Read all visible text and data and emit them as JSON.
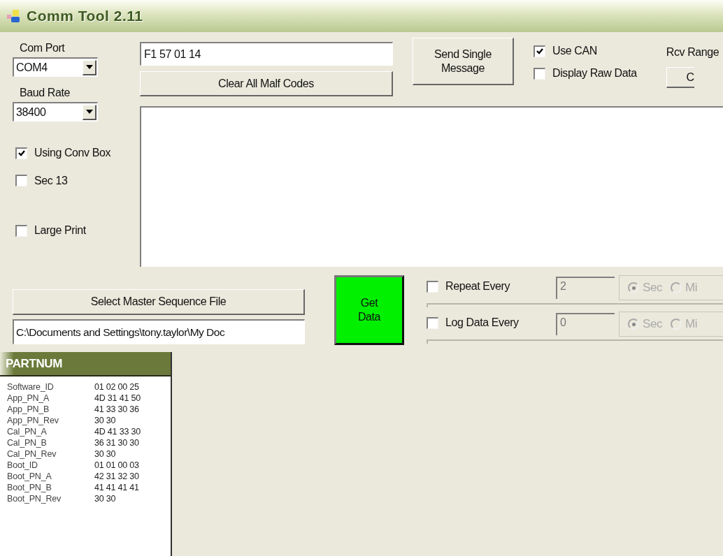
{
  "window": {
    "title": "Comm Tool 2.11"
  },
  "com_port": {
    "label": "Com Port",
    "value": "COM4"
  },
  "baud_rate": {
    "label": "Baud Rate",
    "value": "38400"
  },
  "options": [
    {
      "label": "Using Conv Box",
      "checked": true
    },
    {
      "label": "Sec 13",
      "checked": false
    },
    {
      "label": "Large Print",
      "checked": false
    }
  ],
  "message": {
    "value": "F1 57 01 14"
  },
  "clear_button": "Clear All Malf Codes",
  "send_button": "Send Single Message",
  "can_options": [
    {
      "label": "Use CAN",
      "checked": true
    },
    {
      "label": "Display Raw Data",
      "checked": false
    }
  ],
  "rcv_range": "Rcv Range",
  "cut_button": "C",
  "select_button": "Select Master Sequence File",
  "sequence_path": "C:\\Documents and Settings\\tony.taylor\\My Doc",
  "get_data_button": "Get Data",
  "timers": [
    {
      "label": "Repeat Every",
      "checked": false,
      "value": "2",
      "disabled": true,
      "units": [
        {
          "label": "Sec",
          "selected": true
        },
        {
          "label": "Mi",
          "selected": false
        }
      ]
    },
    {
      "label": "Log Data Every",
      "checked": false,
      "value": "0",
      "disabled": true,
      "units": [
        {
          "label": "Sec",
          "selected": true
        },
        {
          "label": "Mi",
          "selected": false
        }
      ]
    }
  ],
  "partnum": {
    "title": "PARTNUM",
    "rows": [
      {
        "name": "Software_ID",
        "value": "01 02 00 25"
      },
      {
        "name": "App_PN_A",
        "value": "4D 31 41 50"
      },
      {
        "name": "App_PN_B",
        "value": "41 33 30 36"
      },
      {
        "name": "App_PN_Rev",
        "value": "30 30"
      },
      {
        "name": "Cal_PN_A",
        "value": "4D 41 33 30"
      },
      {
        "name": "Cal_PN_B",
        "value": "36 31 30 30"
      },
      {
        "name": "Cal_PN_Rev",
        "value": "30 30"
      },
      {
        "name": "Boot_ID",
        "value": "01 01 00 03"
      },
      {
        "name": "Boot_PN_A",
        "value": "42 31 32 30"
      },
      {
        "name": "Boot_PN_B",
        "value": "41 41 41 41"
      },
      {
        "name": "Boot_PN_Rev",
        "value": "30 30"
      }
    ]
  }
}
